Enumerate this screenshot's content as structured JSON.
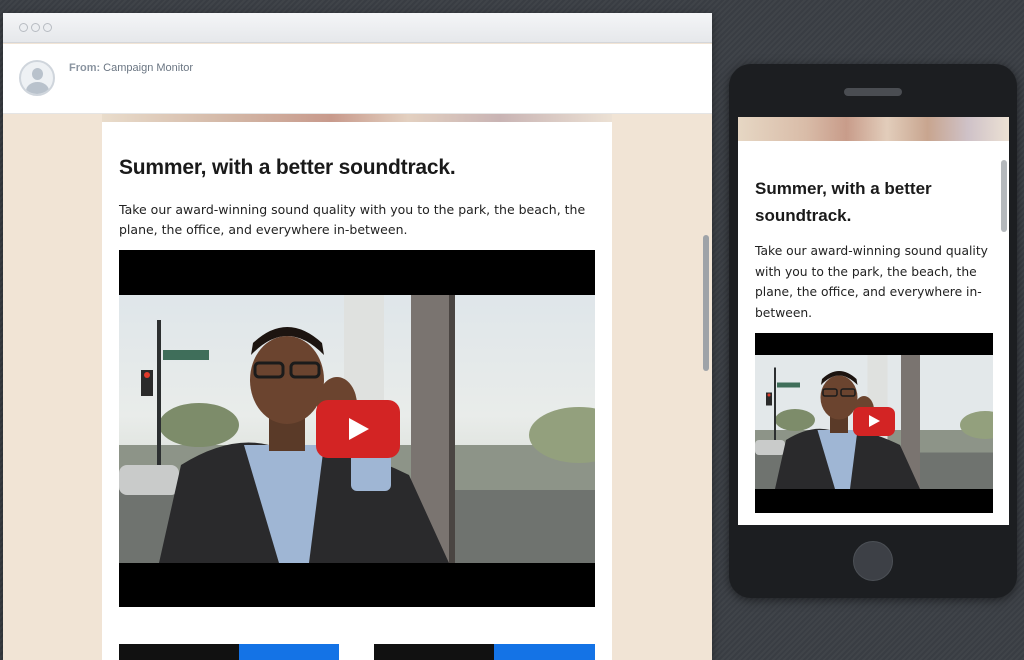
{
  "desktop": {
    "from_label": "From:",
    "from_value": "Campaign Monitor"
  },
  "email": {
    "headline": "Summer, with a better soundtrack.",
    "body": "Take our award-winning sound quality with you to the park, the beach, the plane, the office, and everywhere in-between.",
    "video_thumbnail": "man-with-headphones-on-phone",
    "play_icon": "youtube-play-icon"
  },
  "phone": {
    "headline": "Summer, with a better soundtrack.",
    "body": "Take our award-winning sound quality with you to the park, the beach, the plane, the office, and everywhere in-between."
  },
  "colors": {
    "play_button": "#d32424",
    "email_background": "#f1e4d5",
    "bottom_button_blue": "#1473e6",
    "bottom_button_dark": "#111111"
  }
}
